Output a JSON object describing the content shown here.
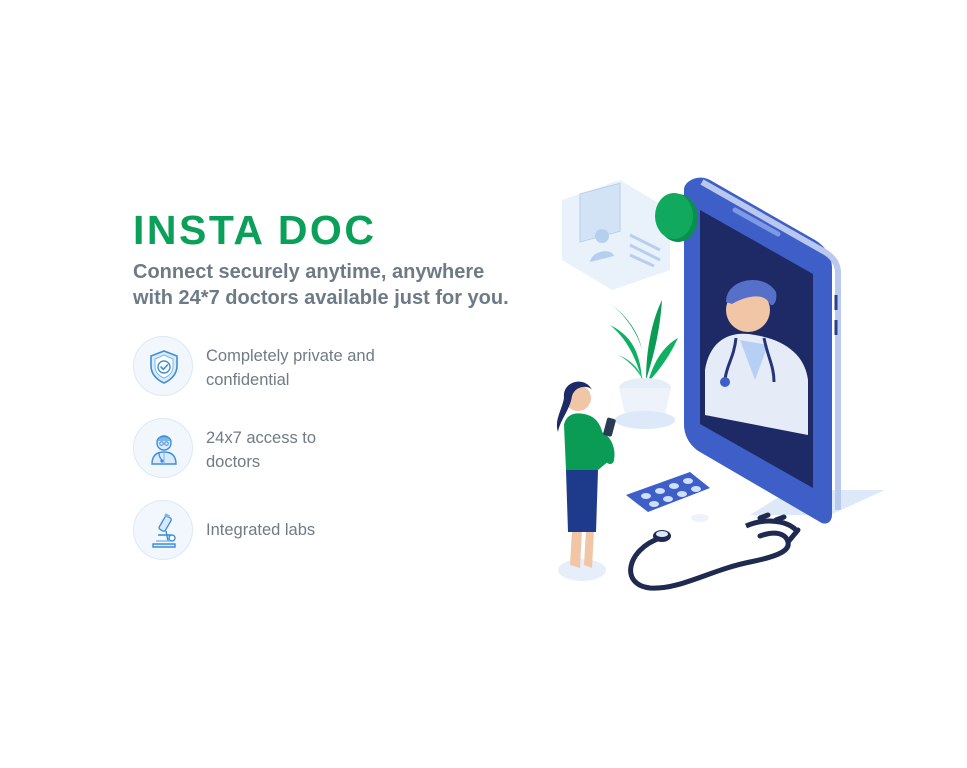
{
  "header": {
    "title": "INSTA DOC",
    "subtitle": "Connect securely anytime, anywhere\nwith 24*7 doctors available just for you."
  },
  "features": [
    {
      "icon": "shield-check-icon",
      "text": "Completely private and\nconfidential"
    },
    {
      "icon": "doctor-icon",
      "text": "24x7 access to\ndoctors"
    },
    {
      "icon": "microscope-icon",
      "text": "Integrated labs"
    }
  ],
  "colors": {
    "brand": "#0aa05a",
    "subtitle": "#6e7a86",
    "feature_text": "#707b85",
    "phone_blue": "#3f5fc8"
  }
}
